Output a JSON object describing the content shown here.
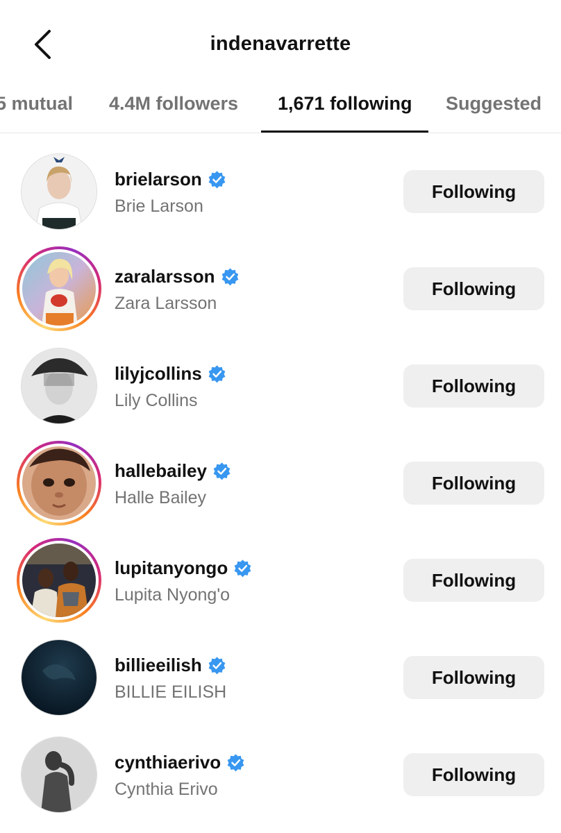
{
  "header": {
    "title": "indenavarrette",
    "back_icon": "chevron-left-icon"
  },
  "tabs": [
    {
      "label": "5 mutual",
      "active": false
    },
    {
      "label": "4.4M followers",
      "active": false
    },
    {
      "label": "1,671 following",
      "active": true
    },
    {
      "label": "Suggested",
      "active": false
    }
  ],
  "colors": {
    "verified_blue": "#3897f0",
    "button_bg": "#efefef",
    "secondary_text": "#737373",
    "story_ring": [
      "#feda75",
      "#fa7e1e",
      "#d62976",
      "#962fbf"
    ]
  },
  "accounts": [
    {
      "username": "brielarson",
      "full_name": "Brie Larson",
      "verified": true,
      "story_ring": false,
      "button_label": "Following"
    },
    {
      "username": "zaralarsson",
      "full_name": "Zara Larsson",
      "verified": true,
      "story_ring": true,
      "button_label": "Following"
    },
    {
      "username": "lilyjcollins",
      "full_name": "Lily Collins",
      "verified": true,
      "story_ring": false,
      "button_label": "Following"
    },
    {
      "username": "hallebailey",
      "full_name": "Halle Bailey",
      "verified": true,
      "story_ring": true,
      "button_label": "Following"
    },
    {
      "username": "lupitanyongo",
      "full_name": "Lupita Nyong'o",
      "verified": true,
      "story_ring": true,
      "button_label": "Following"
    },
    {
      "username": "billieeilish",
      "full_name": "BILLIE EILISH",
      "verified": true,
      "story_ring": false,
      "button_label": "Following"
    },
    {
      "username": "cynthiaerivo",
      "full_name": "Cynthia Erivo",
      "verified": true,
      "story_ring": false,
      "button_label": "Following"
    }
  ]
}
